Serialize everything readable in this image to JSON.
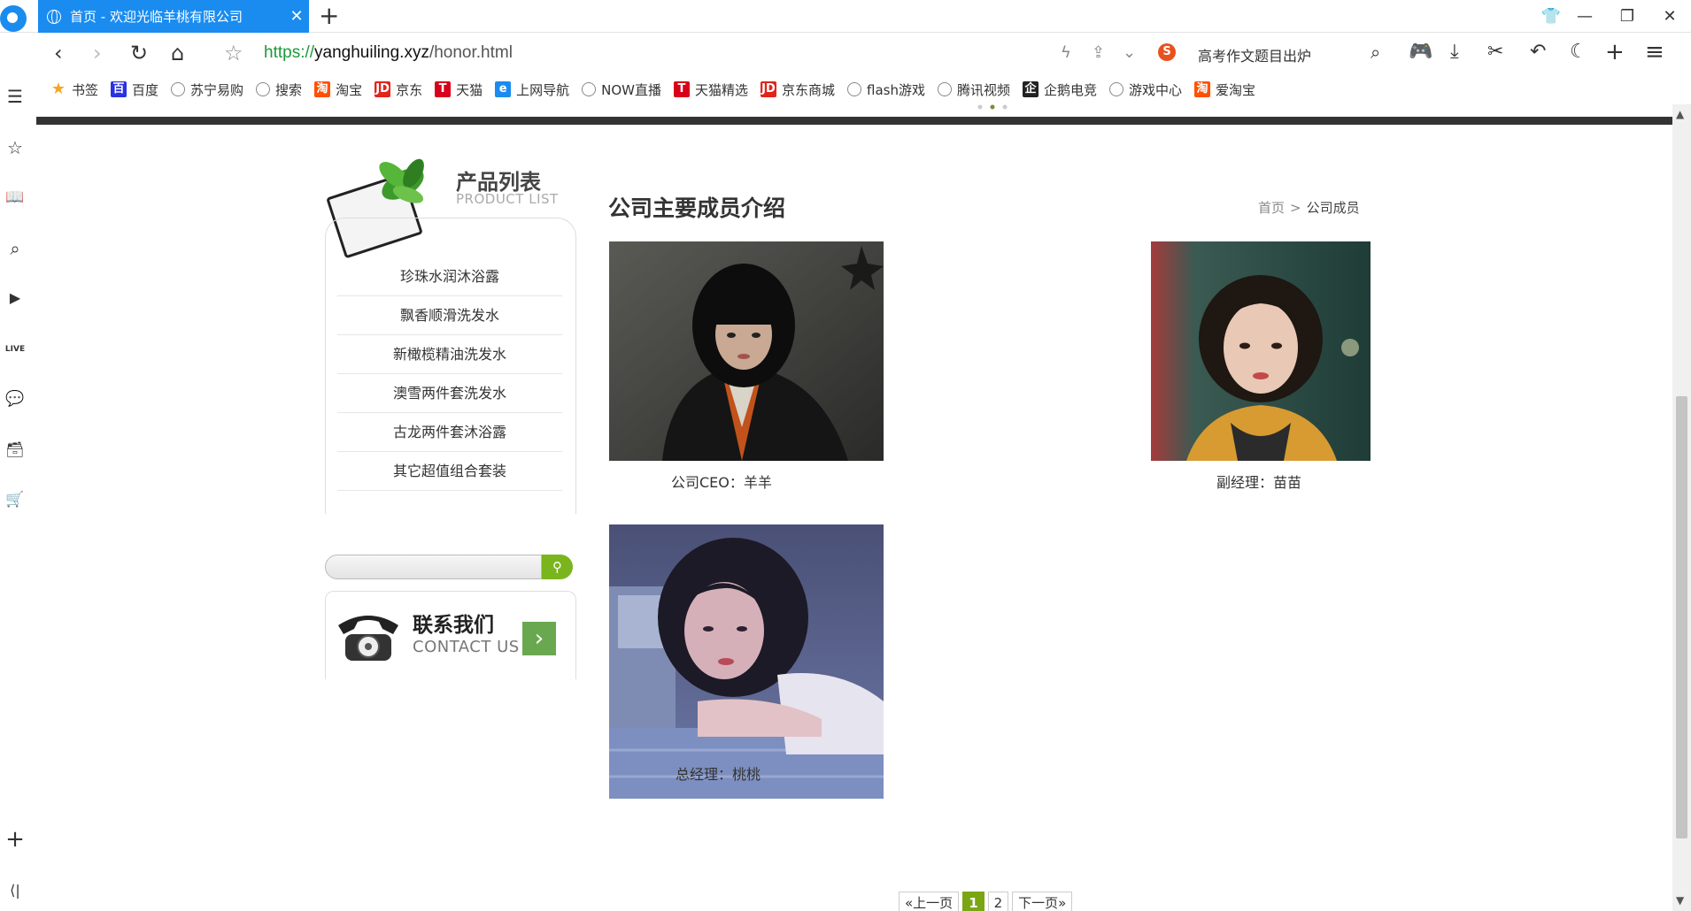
{
  "tab": {
    "title": "首页 - 欢迎光临羊桃有限公司",
    "close": "✕"
  },
  "window": {
    "new_tab": "+",
    "min": "—",
    "restore": "❐",
    "close": "✕",
    "skin": "👕"
  },
  "nav": {
    "back": "‹",
    "forward": "›",
    "reload": "↻",
    "home": "⌂",
    "star": "☆"
  },
  "address": {
    "scheme": "https://",
    "host": "yanghuiling.xyz",
    "path": "/honor.html"
  },
  "address_tools": {
    "bolt": "ϟ",
    "share": "⇪",
    "dropdown": "⌄"
  },
  "search": {
    "engine_logo": "S",
    "query": "高考作文题目出炉",
    "icon": "⌕"
  },
  "toolbar": {
    "game": "🎮",
    "download": "⤓",
    "cut": "✂",
    "undo": "↶",
    "night": "☾",
    "add": "+",
    "menu": "≡"
  },
  "bookmarks": [
    {
      "label": "书签",
      "icon": "★",
      "color": "#f5a623"
    },
    {
      "label": "百度",
      "icon": "百",
      "color": "#2932e1"
    },
    {
      "label": "苏宁易购",
      "icon": "",
      "color": ""
    },
    {
      "label": "搜索",
      "icon": "",
      "color": ""
    },
    {
      "label": "淘宝",
      "icon": "淘",
      "color": "#ff5000"
    },
    {
      "label": "京东",
      "icon": "JD",
      "color": "#e1251b"
    },
    {
      "label": "天猫",
      "icon": "T",
      "color": "#d9001b"
    },
    {
      "label": "上网导航",
      "icon": "e",
      "color": "#1a8cf0"
    },
    {
      "label": "NOW直播",
      "icon": "",
      "color": ""
    },
    {
      "label": "天猫精选",
      "icon": "T",
      "color": "#d9001b"
    },
    {
      "label": "京东商城",
      "icon": "JD",
      "color": "#e1251b"
    },
    {
      "label": "flash游戏",
      "icon": "",
      "color": ""
    },
    {
      "label": "腾讯视频",
      "icon": "",
      "color": ""
    },
    {
      "label": "企鹅电竞",
      "icon": "企",
      "color": "#222222"
    },
    {
      "label": "游戏中心",
      "icon": "",
      "color": ""
    },
    {
      "label": "爱淘宝",
      "icon": "淘",
      "color": "#ff5000"
    }
  ],
  "sidebar": {
    "news": "☰",
    "favorites": "☆",
    "reader": "📖",
    "search": "⌕",
    "video": "▶",
    "live": "LIVE",
    "chat": "💬",
    "toolbox": "🗃",
    "cart": "🛒",
    "add": "+",
    "collapse": "⟨|"
  },
  "products": {
    "title": "产品列表",
    "subtitle": "PRODUCT LIST",
    "items": [
      "珍珠水润沐浴露",
      "飘香顺滑洗发水",
      "新橄榄精油洗发水",
      "澳雪两件套洗发水",
      "古龙两件套沐浴露",
      "其它超值组合套装"
    ]
  },
  "side_search": {
    "button_icon": "⚲",
    "value": ""
  },
  "contact": {
    "title": "联系我们",
    "subtitle": "CONTACT US",
    "arrow": "›"
  },
  "main": {
    "title": "公司主要成员介绍",
    "breadcrumb": {
      "home": "首页",
      "sep": ">",
      "current": "公司成员"
    },
    "members": [
      {
        "caption": "公司CEO：羊羊"
      },
      {
        "caption": "副经理：苗苗"
      },
      {
        "caption": "总经理：桃桃"
      }
    ]
  },
  "pagination": {
    "prev": "«上一页",
    "pages": [
      "1",
      "2"
    ],
    "current": "1",
    "next": "下一页»"
  },
  "scrollbar": {
    "up": "▲",
    "down": "▼"
  }
}
